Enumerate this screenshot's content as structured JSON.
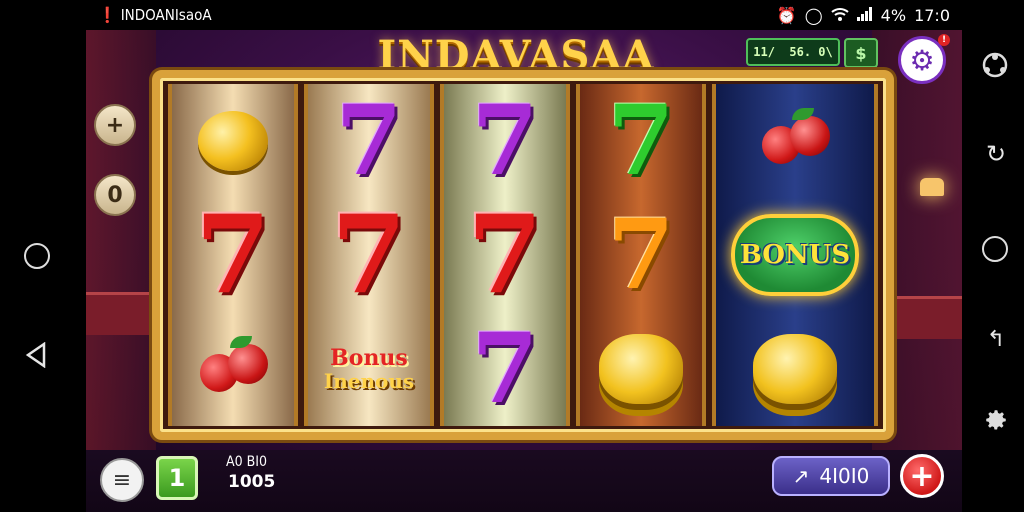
{
  "status_bar": {
    "app_label": "INDOANIsaoA",
    "battery": "4%",
    "time": "17:0"
  },
  "game": {
    "title": "INDAVASAA",
    "counter_value": "11/  56. 0\\",
    "money_icon": "$",
    "settings_notification": "!",
    "side_buttons": {
      "plus": "+",
      "zero": "0"
    },
    "reels": [
      {
        "top": "coin",
        "middle": "7",
        "middle_color": "red",
        "bottom": "fruit"
      },
      {
        "top": "7",
        "top_color": "purple",
        "middle": "7",
        "middle_color": "red",
        "bottom": "bonus"
      },
      {
        "top": "7",
        "top_color": "purple",
        "middle": "7",
        "middle_color": "red",
        "bottom": "7",
        "bottom_color": "purple"
      },
      {
        "top": "7",
        "top_color": "green",
        "middle": "7",
        "middle_color": "orange",
        "bottom": "coin-stack"
      },
      {
        "top": "fruit",
        "middle": "bonus-badge",
        "bottom": "coin-stack"
      }
    ],
    "bonus_symbol": {
      "line1": "Bonus",
      "line2": "Inenous"
    },
    "bonus_badge": "BONUS"
  },
  "bottom_bar": {
    "menu_icon": "≡",
    "level": "1",
    "win_label": "A0 BI0",
    "win_value": "1005",
    "bet_icon": "↗",
    "bet_value": "4I0I0",
    "spin_icon": "+"
  },
  "colors": {
    "accent_gold": "#ffd24a",
    "frame": "#d9a13a",
    "bet_button": "#4b3fa8",
    "spin_button": "#d01818"
  }
}
